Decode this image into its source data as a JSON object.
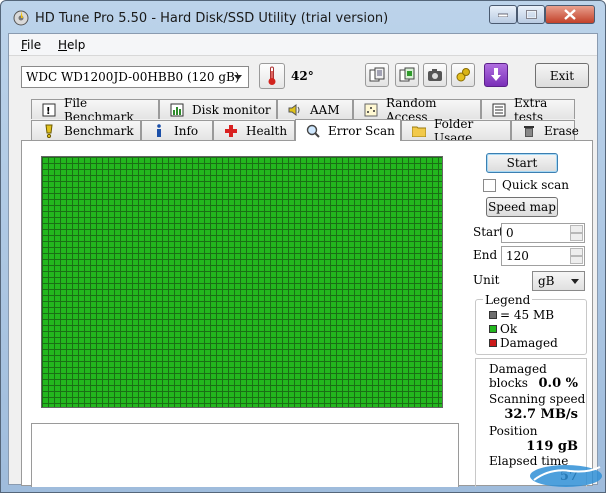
{
  "window": {
    "title": "HD Tune Pro 5.50 - Hard Disk/SSD Utility (trial version)"
  },
  "menu": {
    "file": "File",
    "help": "Help"
  },
  "toolbar": {
    "drive": "WDC WD1200JD-00HBB0 (120 gB)",
    "temperature": "42°",
    "exit_label": "Exit",
    "icons": [
      "copy-text-icon",
      "copy-screen-icon",
      "screenshot-icon",
      "options-icon",
      "save-icon"
    ]
  },
  "tabs": {
    "row1": [
      "File Benchmark",
      "Disk monitor",
      "AAM",
      "Random Access",
      "Extra tests"
    ],
    "row2": [
      "Benchmark",
      "Info",
      "Health",
      "Error Scan",
      "Folder Usage",
      "Erase"
    ],
    "active": "Error Scan"
  },
  "scan": {
    "start_label": "Start",
    "quick_scan_label": "Quick scan",
    "quick_scan_checked": false,
    "speed_map_label": "Speed map",
    "start_field_label": "Start",
    "start_value": "0",
    "end_field_label": "End",
    "end_value": "120",
    "unit_label": "Unit",
    "unit_value": "gB"
  },
  "legend": {
    "title": "Legend",
    "items": [
      {
        "label": "= 45 MB",
        "color": "#6e6e6e"
      },
      {
        "label": "Ok",
        "color": "#23b71e"
      },
      {
        "label": "Damaged",
        "color": "#cc1a1a"
      }
    ]
  },
  "stats": {
    "damaged_blocks_label": "Damaged blocks",
    "damaged_blocks_value": "0.0 %",
    "scanning_speed_label": "Scanning speed",
    "scanning_speed_value": "32.7 MB/s",
    "position_label": "Position",
    "position_value": "119 gB",
    "elapsed_time_label": "Elapsed time",
    "elapsed_time_value": "57"
  },
  "colors": {
    "block_ok": "#23b71e",
    "block_grid": "#1a6f15"
  },
  "watermark": {
    "text": "iT邦幫忙"
  }
}
